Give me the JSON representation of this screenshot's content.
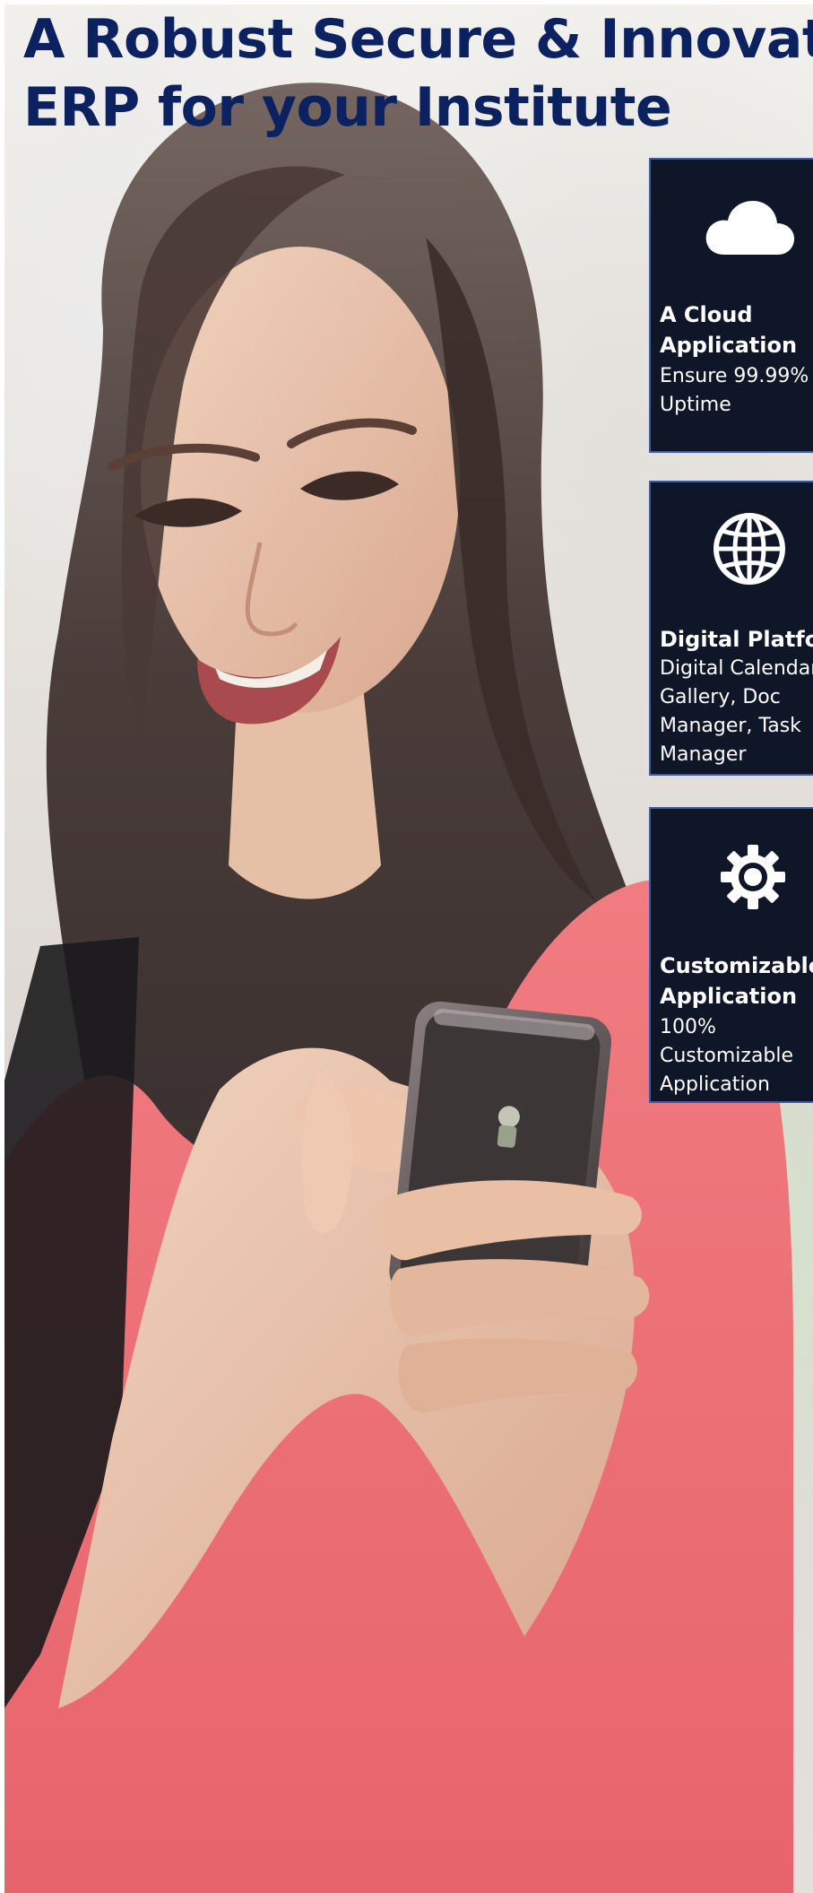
{
  "headline": {
    "line1": "A Robust Secure & Innovative",
    "line2": "ERP for your Institute"
  },
  "features": [
    {
      "icon": "cloud-icon",
      "title": "A Cloud\nApplication",
      "description": "Ensure 99.99%\nUptime"
    },
    {
      "icon": "globe-icon",
      "title": "Digital Platform",
      "description": "Digital Calendar,\nGallery, Doc\nManager, Task\nManager"
    },
    {
      "icon": "gear-icon",
      "title": "Customizable\nApplication",
      "description": "100%\nCustomizable\nApplication"
    }
  ],
  "colors": {
    "headline": "#0c2260",
    "card_background": "#0e1627",
    "card_border": "#3b5aa8"
  }
}
